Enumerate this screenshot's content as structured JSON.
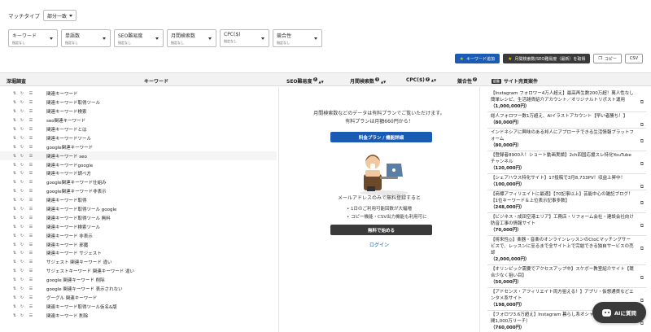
{
  "match_type": {
    "label": "マッチタイプ",
    "value": "部分一致"
  },
  "filters": [
    {
      "name": "キーワード",
      "sub": "指定なし"
    },
    {
      "name": "単語数",
      "sub": "指定なし"
    },
    {
      "name": "SEO難易度",
      "sub": "指定なし"
    },
    {
      "name": "月間検索数",
      "sub": "指定なし"
    },
    {
      "name": "CPC($)",
      "sub": "指定なし"
    },
    {
      "name": "競合性",
      "sub": "指定なし"
    }
  ],
  "actions": {
    "add_keyword": "キーワード追加",
    "get_volume": "月間検索数/SEO難易度（最新）を取得",
    "copy": "コピー",
    "csv": "CSV"
  },
  "columns": {
    "deep_research": "深堀調査",
    "keyword": "キーワード",
    "seo": "SEO難易度",
    "volume": "月間検索数",
    "cpc": "CPC($)",
    "competition": "競合性",
    "pr": "広告",
    "sites": "サイト売買案件"
  },
  "keywords": [
    "関連キーワード",
    "関連キーワード取得ツール",
    "関連キーワード検索",
    "seo関連キーワード",
    "関連キーワードとは",
    "関連キーワードツール",
    "google関連キーワード",
    "関連キーワード seo",
    "関連キーワードgoogle",
    "関連キーワード調べ方",
    "google関連キーワード仕組み",
    "google関連キーワード非表示",
    "関連キーワード取得",
    "関連キーワード取得ツール google",
    "関連キーワード取得ツール 無料",
    "関連キーワード検索ツール",
    "関連キーワード 非表示",
    "関連キーワード 邪魔",
    "関連キーワード サジェスト",
    "サジェスト 関連キーワード 違い",
    "サジェストキーワード 関連キーワード 違い",
    "google 関連キーワード 削除",
    "google 関連キーワード 表示されない",
    "グーグル 関連キーワード",
    "関連キーワード取得ツール仮名&版",
    "関連キーワード 削除"
  ],
  "paywall": {
    "line1": "月間検索数などのデータは有料プランでご覧いただけます。",
    "line2": "有料プランは月額660円から！",
    "plan_button": "料金プラン / 機能詳細",
    "line3": "メールアドレスのみで無料登録すると",
    "bullet1": "1日のご利用可能回数が大幅増",
    "bullet2": "コピー機能・CSV出力機能も利用可に",
    "start_button": "無料で始める",
    "login": "ログイン"
  },
  "sites": [
    {
      "title": "【Instagram フォロワー4万人超え】最高再生数200万超！萬人性なし簡単レシピ、生活雑貨紹介アカウント／オリジナルトリポスト運用",
      "price": "（1,000,000円）"
    },
    {
      "title": "総人フォロワー数1万超え、AIイラストアカウント【早い者勝ち！】",
      "price": "（80,000円）"
    },
    {
      "title": "インドネシアに興味のある邦人にアプローチできる生活情報プラットフォーム",
      "price": "（80,000円）"
    },
    {
      "title": "【登録者8900人！ショート動画実績】2ch四国応援スレ特化YouTubeチャンネル",
      "price": "（120,000円）"
    },
    {
      "title": "【シェアハウス特化サイト】17投稿で3月8,733PV！収益上昇中！",
      "price": "（100,000円）"
    },
    {
      "title": "【商標アフィリエイトに最適】【70記事以上】芸能中心の雑記ブログ！【1位キーワード＆上位表示記事多数】",
      "price": "（248,000円）"
    },
    {
      "title": "【ビジネス・成田空港エリア】工務店・リフォーム会社・建設会社向け　防音工事の情報サイト",
      "price": "（70,000円）"
    },
    {
      "title": "【将来性◎】楽器・音楽のオンラインレッスンのCtoCマッチングサービスで、レッスンに至るまで全サイト上で完結できる独自サービスの売却",
      "price": "（2,000,000円）"
    },
    {
      "title": "【オリンピック需要でアクセスアップ中】スケボー教室紹介サイト【競合少なく狙い目】",
      "price": "（50,000円）"
    },
    {
      "title": "【アドセンス・アフィリエイト両方狙える！】アプリ・仮想通貨などエンタメ系サイト",
      "price": "（198,000円）"
    },
    {
      "title": "【フォロワ3.6万超え】Instagram 暮らし系オシャレ雑貨紹介アカ（月間1,000万リーチ）",
      "price": "（760,000円）"
    }
  ],
  "ai_button": "AIに質問"
}
